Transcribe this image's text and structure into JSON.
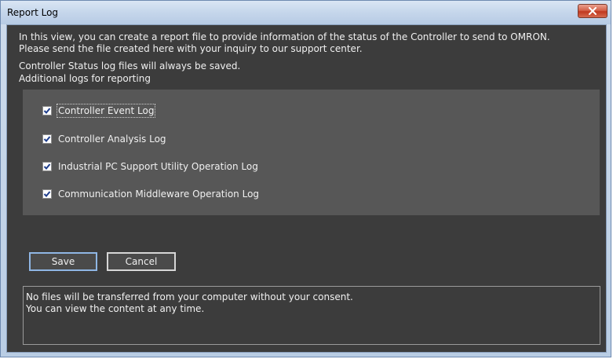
{
  "window": {
    "title": "Report Log"
  },
  "intro": {
    "line1": "In this view, you can create a report file to provide information of the status of the Controller to send to OMRON.",
    "line2": "Please send the file created here with your inquiry to our support center."
  },
  "status": {
    "line1": "Controller Status log files will always be saved.",
    "line2": "Additional logs for reporting"
  },
  "options": [
    {
      "label": "Controller Event Log",
      "checked": true
    },
    {
      "label": "Controller Analysis Log",
      "checked": true
    },
    {
      "label": "Industrial PC Support Utility Operation Log",
      "checked": true
    },
    {
      "label": "Communication Middleware Operation Log",
      "checked": true
    }
  ],
  "buttons": {
    "save_label": "Save",
    "cancel_label": "Cancel"
  },
  "info": {
    "line1": "No files will be transferred from your computer without your consent.",
    "line2": "You can view the content at any time."
  },
  "colors": {
    "client_background": "#3c3c3c",
    "panel_background": "#575757",
    "checkbox_check": "#1f3e8c",
    "close_button": "#c74a30"
  },
  "icons": {
    "close": "close-x-icon",
    "checkbox": "checkmark-icon"
  }
}
